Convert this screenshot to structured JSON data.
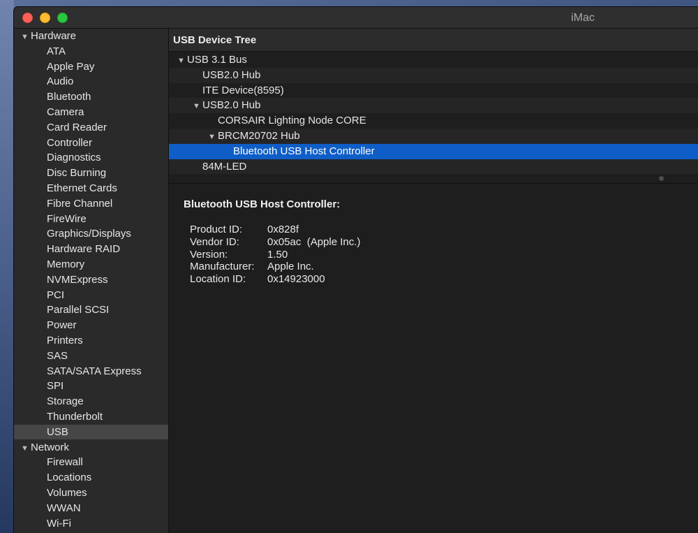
{
  "window": {
    "title": "iMac"
  },
  "sidebar": {
    "sections": [
      {
        "label": "Hardware",
        "items": [
          "ATA",
          "Apple Pay",
          "Audio",
          "Bluetooth",
          "Camera",
          "Card Reader",
          "Controller",
          "Diagnostics",
          "Disc Burning",
          "Ethernet Cards",
          "Fibre Channel",
          "FireWire",
          "Graphics/Displays",
          "Hardware RAID",
          "Memory",
          "NVMExpress",
          "PCI",
          "Parallel SCSI",
          "Power",
          "Printers",
          "SAS",
          "SATA/SATA Express",
          "SPI",
          "Storage",
          "Thunderbolt",
          "USB"
        ]
      },
      {
        "label": "Network",
        "items": [
          "Firewall",
          "Locations",
          "Volumes",
          "WWAN",
          "Wi-Fi"
        ]
      }
    ],
    "selected": "USB"
  },
  "tree": {
    "header": "USB Device Tree",
    "rows": [
      {
        "label": "USB 3.1 Bus",
        "level": 0,
        "expanded": true
      },
      {
        "label": "USB2.0 Hub",
        "level": 1
      },
      {
        "label": "ITE Device(8595)",
        "level": 1
      },
      {
        "label": "USB2.0 Hub",
        "level": 1,
        "expanded": true
      },
      {
        "label": "CORSAIR Lighting Node CORE",
        "level": 2
      },
      {
        "label": "BRCM20702 Hub",
        "level": 2,
        "expanded": true
      },
      {
        "label": "Bluetooth USB Host Controller",
        "level": 3,
        "selected": true
      },
      {
        "label": "84M-LED",
        "level": 1
      }
    ]
  },
  "detail": {
    "title": "Bluetooth USB Host Controller:",
    "fields": [
      {
        "key": "Product ID:",
        "value": "0x828f"
      },
      {
        "key": "Vendor ID:",
        "value": "0x05ac  (Apple Inc.)"
      },
      {
        "key": "Version:",
        "value": "1.50"
      },
      {
        "key": "Manufacturer:",
        "value": "Apple Inc."
      },
      {
        "key": "Location ID:",
        "value": "0x14923000"
      }
    ]
  },
  "colors": {
    "selection": "#0f5ec7",
    "sidebar_selected": "#464646"
  },
  "icons": {
    "disclosure_expanded": "triangle-down-icon"
  }
}
